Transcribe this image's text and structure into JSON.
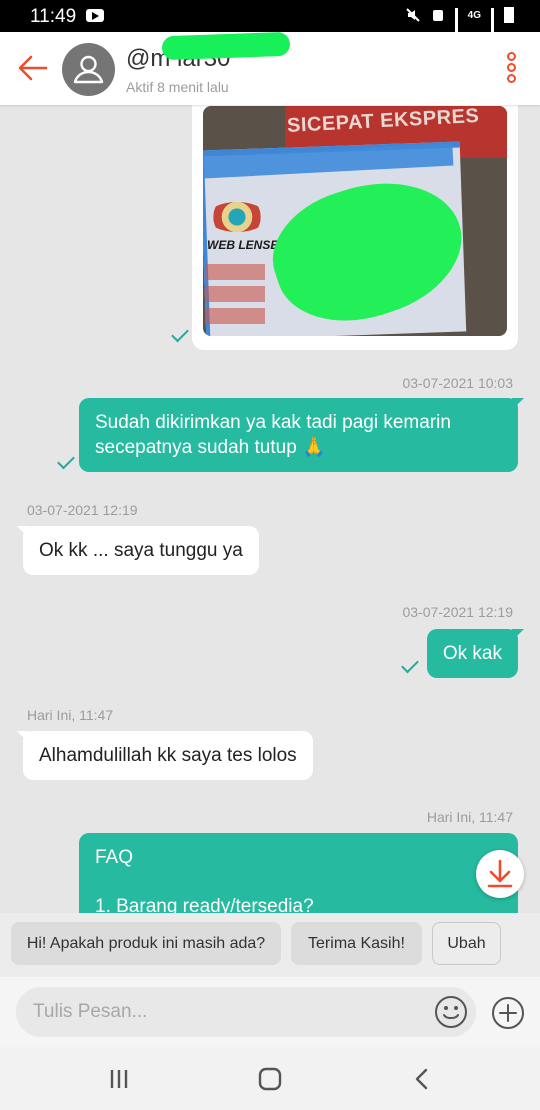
{
  "status_bar": {
    "time": "11:49",
    "network": "4G"
  },
  "header": {
    "username": "@m   lar30",
    "last_active": "Aktif 8 menit lalu"
  },
  "image_message": {
    "sign_text": "SICEPAT EKSPRES",
    "logo_text": "WEB LENSE"
  },
  "messages": [
    {
      "direction": "out",
      "timestamp": "03-07-2021 10:03",
      "text": "Sudah dikirimkan ya kak tadi pagi kemarin secepatnya sudah tutup 🙏"
    },
    {
      "direction": "in",
      "timestamp": "03-07-2021 12:19",
      "text": "Ok kk ... saya tunggu ya"
    },
    {
      "direction": "out",
      "timestamp": "03-07-2021 12:19",
      "text": "Ok kak"
    },
    {
      "direction": "in",
      "timestamp": "Hari Ini, 11:47",
      "text": "Alhamdulillah kk saya tes lolos"
    },
    {
      "direction": "out",
      "timestamp": "Hari Ini, 11:47",
      "title": "FAQ",
      "text": "1. Barang ready/tersedia?"
    }
  ],
  "quick_replies": [
    "Hi! Apakah produk ini masih ada?",
    "Terima Kasih!",
    "Ubah"
  ],
  "input": {
    "placeholder": "Tulis Pesan..."
  },
  "colors": {
    "accent": "#ee4d2d",
    "bubble_out": "#26baa0",
    "check": "#26aa99"
  },
  "icons": [
    "back-arrow-icon",
    "avatar-icon",
    "more-vertical-icon",
    "checkmark-icon",
    "download-icon",
    "emoji-icon",
    "plus-icon",
    "recent-apps-icon",
    "home-icon",
    "back-icon"
  ]
}
